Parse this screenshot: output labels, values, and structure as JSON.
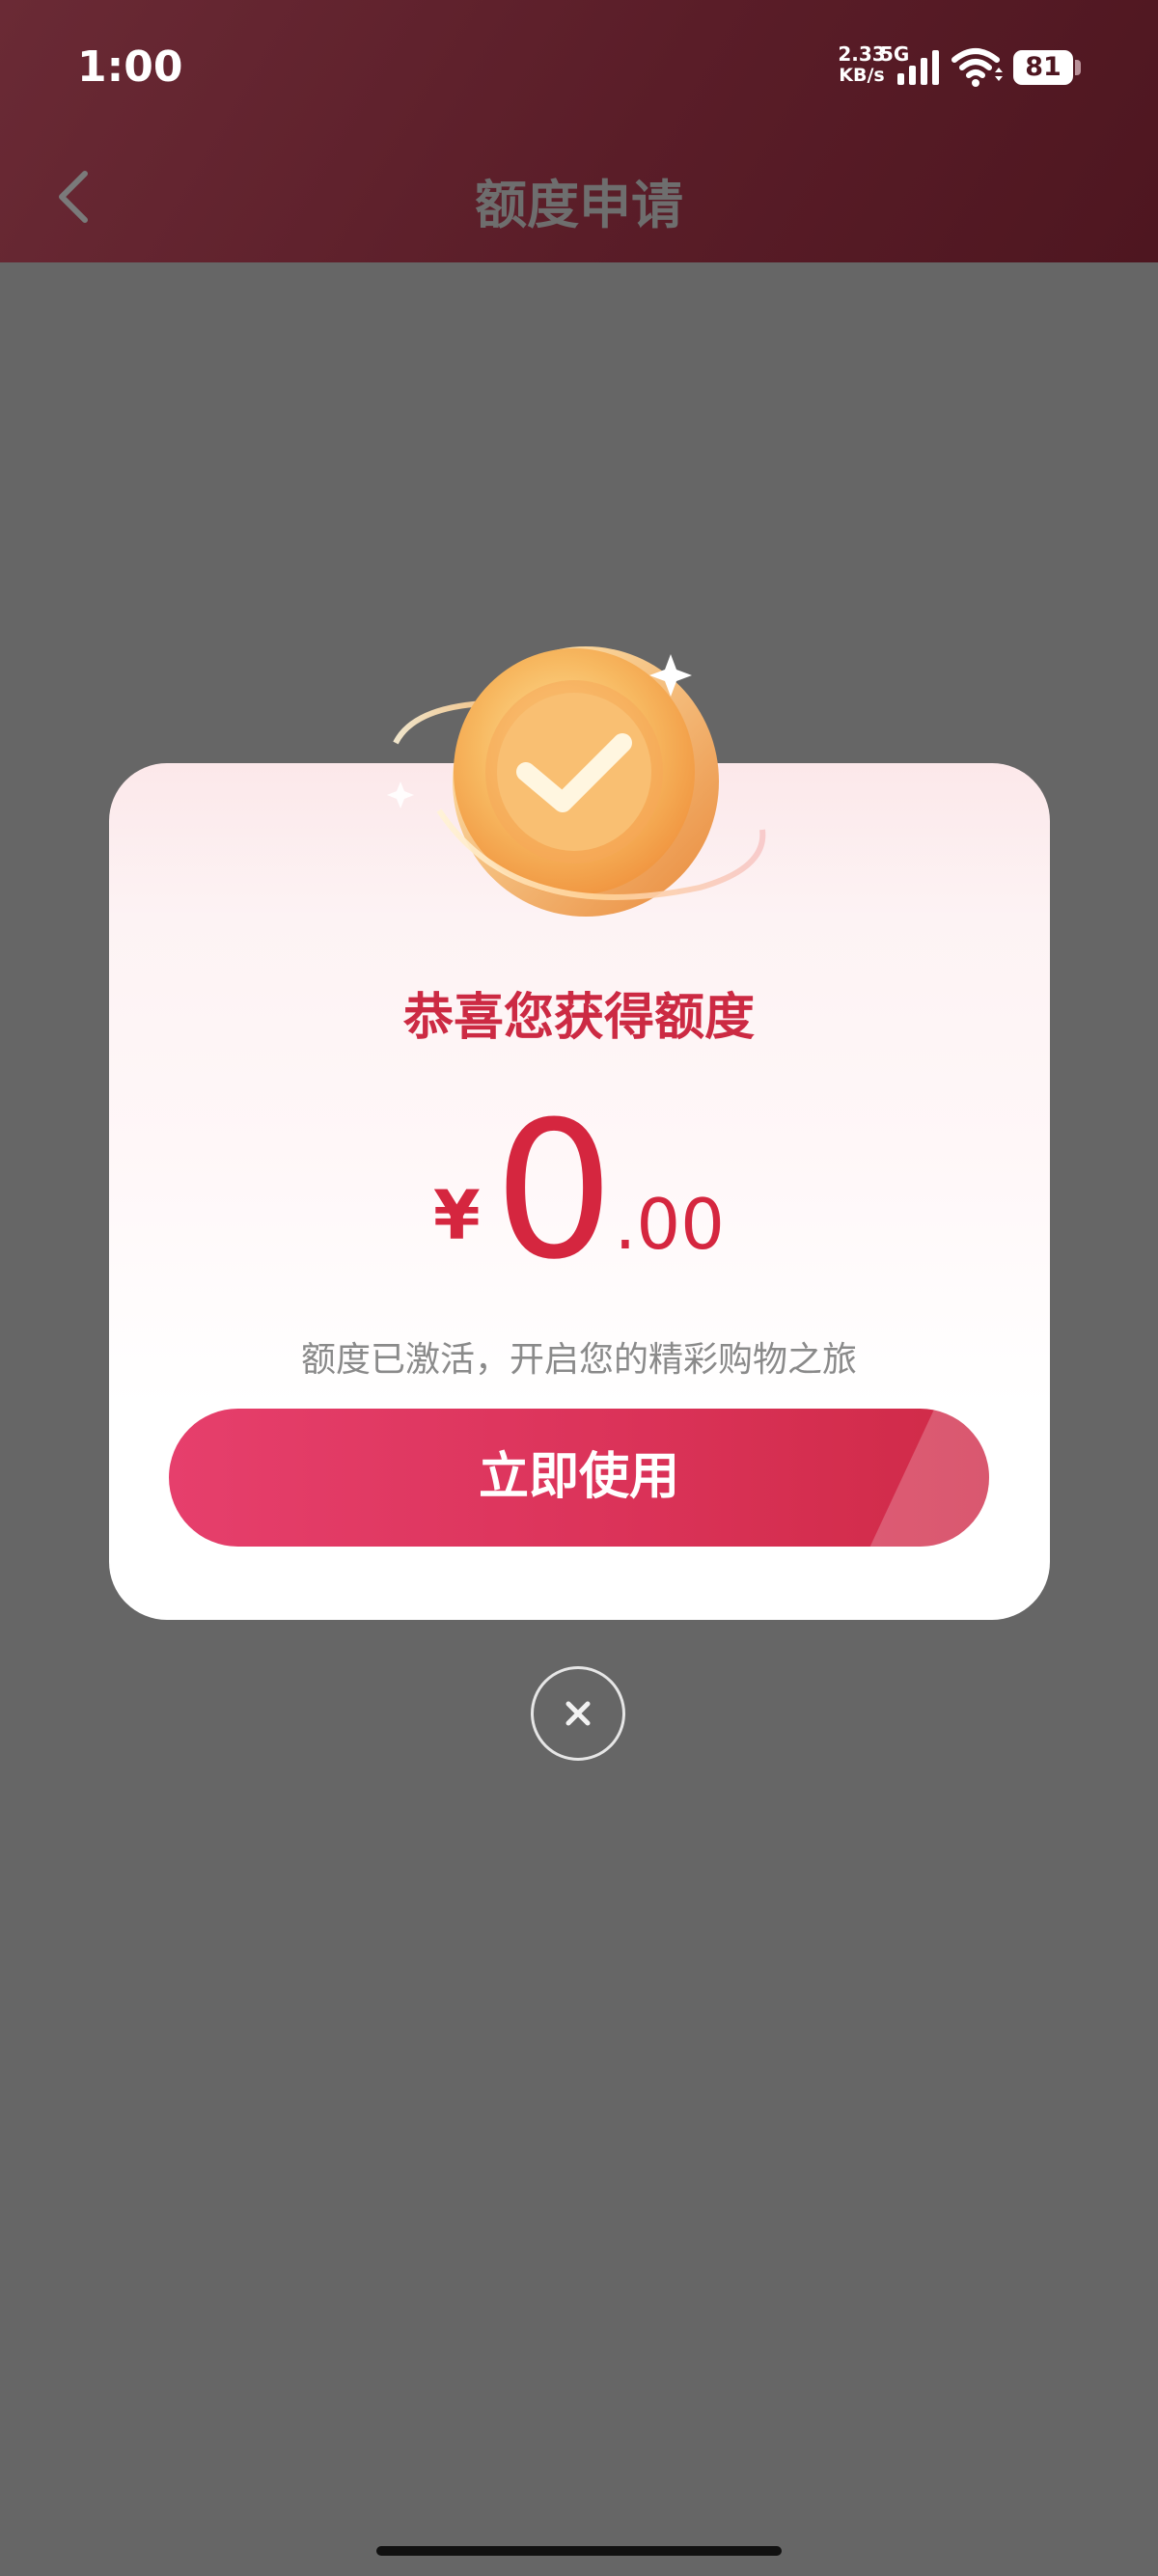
{
  "status_bar": {
    "time": "1:00",
    "net_speed_value": "2.33",
    "net_speed_unit": "KB/s",
    "network_type": "5G",
    "battery_level": "81"
  },
  "nav": {
    "title": "额度申请",
    "back_icon": "chevron-left-icon"
  },
  "modal": {
    "illustration_icon": "gold-coin-check-icon",
    "headline": "恭喜您获得额度",
    "amount": {
      "currency": "¥",
      "integer": "0",
      "decimal": ".00"
    },
    "subtext": "额度已激活，开启您的精彩购物之旅",
    "primary_button_label": "立即使用",
    "close_icon": "close-icon"
  },
  "colors": {
    "header_bg": "#5a1d28",
    "overlay": "#666666",
    "accent_red": "#d5263f",
    "button_start": "#e63f6c",
    "button_end": "#cf2a47"
  }
}
